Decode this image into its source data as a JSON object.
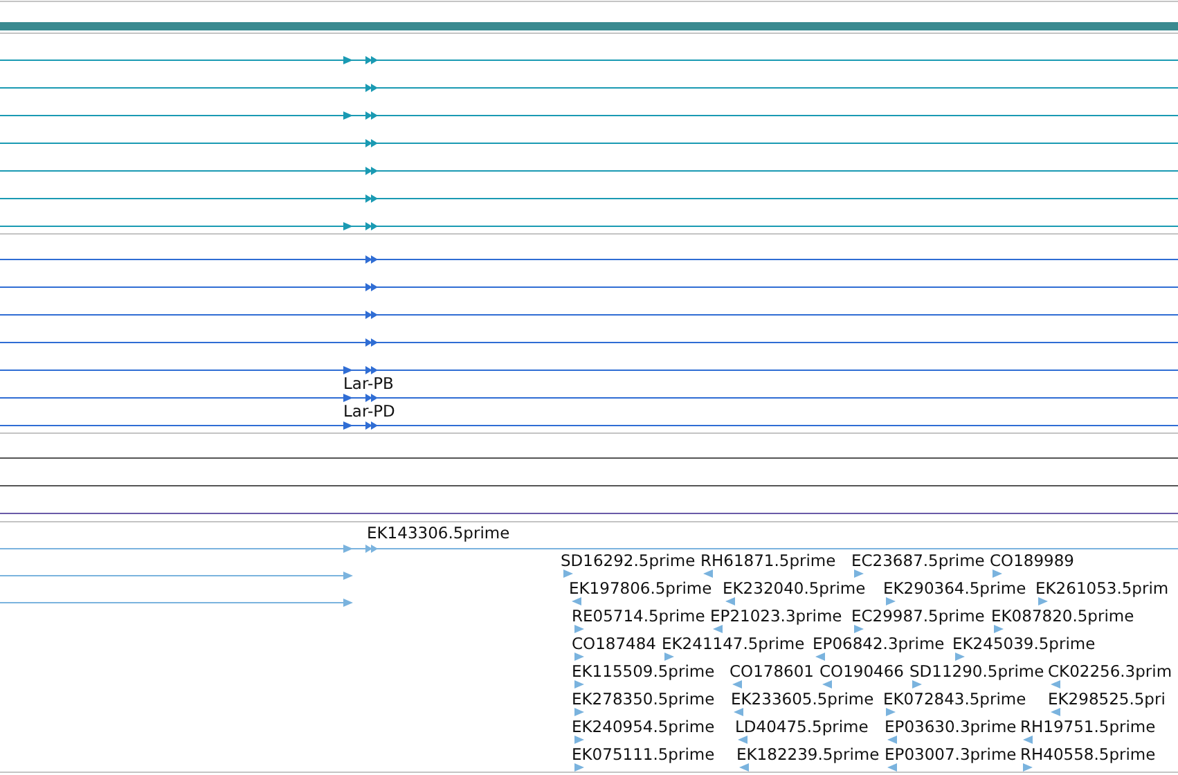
{
  "tracks": [
    {
      "color": "#1a9ab3",
      "features": [
        {
          "kind": "gene",
          "start_arrow": true
        },
        {
          "kind": "gene",
          "start_arrow": false
        },
        {
          "kind": "gene",
          "start_arrow": true
        },
        {
          "kind": "gene",
          "start_arrow": false
        },
        {
          "kind": "gene",
          "start_arrow": false
        },
        {
          "kind": "gene",
          "start_arrow": false
        },
        {
          "kind": "gene",
          "start_arrow": true
        }
      ]
    },
    {
      "color": "#2f6dd4",
      "features": [
        {
          "kind": "gene",
          "start_arrow": false
        },
        {
          "kind": "gene",
          "start_arrow": false
        },
        {
          "kind": "gene",
          "start_arrow": false
        },
        {
          "kind": "gene",
          "start_arrow": false
        },
        {
          "kind": "gene",
          "start_arrow": true,
          "label": "Lar-PB"
        },
        {
          "kind": "gene",
          "start_arrow": true,
          "label": "Lar-PD"
        },
        {
          "kind": "gene",
          "start_arrow": true
        }
      ]
    },
    {
      "color": "#7ab3de",
      "features": [
        {
          "kind": "gene",
          "start_arrow": true,
          "label_above": "EK143306.5prime"
        },
        {
          "kind": "stub",
          "start_arrow": true
        },
        {
          "kind": "stub",
          "start_arrow": true
        }
      ]
    }
  ],
  "est_rows_x": [
    [
      {
        "name": "SD16292.5prime",
        "reverse": false
      },
      {
        "name": "RH61871.5prime",
        "reverse": true
      },
      {
        "name": "EC23687.5prime",
        "reverse": false
      },
      {
        "name": "CO189989",
        "reverse": false
      }
    ],
    [
      {
        "name": "EK197806.5prime",
        "reverse": true
      },
      {
        "name": "EK232040.5prime",
        "reverse": true
      },
      {
        "name": "EK290364.5prime",
        "reverse": false
      },
      {
        "name": "EK261053.5prim",
        "reverse": false
      }
    ],
    [
      {
        "name": "RE05714.5prime",
        "reverse": false
      },
      {
        "name": "EP21023.3prime",
        "reverse": true
      },
      {
        "name": "EC29987.5prime",
        "reverse": false
      },
      {
        "name": "EK087820.5prime",
        "reverse": false
      }
    ],
    [
      {
        "name": "CO187484",
        "reverse": false
      },
      {
        "name": "EK241147.5prime",
        "reverse": false
      },
      {
        "name": "EP06842.3prime",
        "reverse": true
      },
      {
        "name": "EK245039.5prime",
        "reverse": false
      }
    ],
    [
      {
        "name": "EK115509.5prime",
        "reverse": false
      },
      {
        "name": "CO178601",
        "reverse": true
      },
      {
        "name": "CO190466",
        "reverse": true
      },
      {
        "name": "SD11290.5prime",
        "reverse": false
      },
      {
        "name": "CK02256.3prim",
        "reverse": true
      }
    ],
    [
      {
        "name": "EK278350.5prime",
        "reverse": false
      },
      {
        "name": "EK233605.5prime",
        "reverse": true
      },
      {
        "name": "EK072843.5prime",
        "reverse": false
      },
      {
        "name": "EK298525.5pri",
        "reverse": true
      }
    ],
    [
      {
        "name": "EK240954.5prime",
        "reverse": false
      },
      {
        "name": "LD40475.5prime",
        "reverse": true
      },
      {
        "name": "EP03630.3prime",
        "reverse": true
      },
      {
        "name": "RH19751.5prime",
        "reverse": true
      }
    ],
    [
      {
        "name": "EK075111.5prime",
        "reverse": false
      },
      {
        "name": "EK182239.5prime",
        "reverse": true
      },
      {
        "name": "EP03007.3prime",
        "reverse": true
      },
      {
        "name": "RH40558.5prime",
        "reverse": false
      }
    ]
  ]
}
